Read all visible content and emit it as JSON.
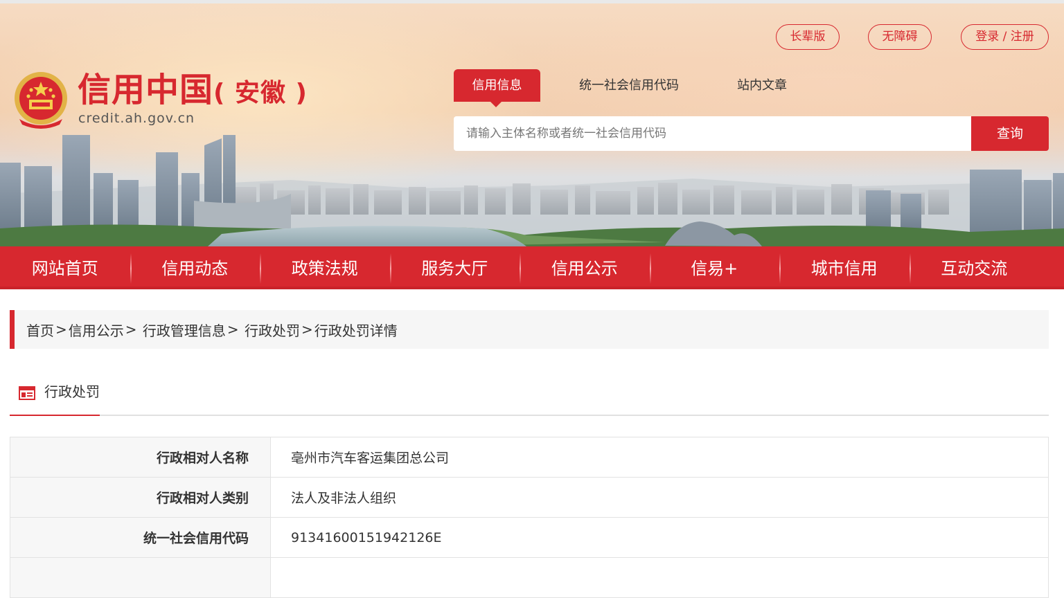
{
  "site": {
    "title_main": "信用中国",
    "title_province": "( 安徽 )",
    "domain": "credit.ah.gov.cn"
  },
  "top_links": {
    "elder": "长辈版",
    "accessible": "无障碍",
    "login": "登录 / 注册"
  },
  "search": {
    "tabs": [
      "信用信息",
      "统一社会信用代码",
      "站内文章"
    ],
    "placeholder": "请输入主体名称或者统一社会信用代码",
    "button": "查询"
  },
  "nav": [
    "网站首页",
    "信用动态",
    "政策法规",
    "服务大厅",
    "信用公示",
    "信易+",
    "城市信用",
    "互动交流"
  ],
  "breadcrumb": [
    "首页",
    "信用公示",
    " 行政管理信息",
    " 行政处罚",
    "行政处罚详情"
  ],
  "section": {
    "title": "行政处罚"
  },
  "detail_rows": [
    {
      "label": "行政相对人名称",
      "value": "亳州市汽车客运集团总公司"
    },
    {
      "label": "行政相对人类别",
      "value": "法人及非法人组织"
    },
    {
      "label": "统一社会信用代码",
      "value": "91341600151942126E"
    },
    {
      "label": "",
      "value": ""
    }
  ],
  "colors": {
    "accent": "#d7282f",
    "crumb_bg": "#f6f6f6",
    "label_bg": "#f7f7f7"
  }
}
